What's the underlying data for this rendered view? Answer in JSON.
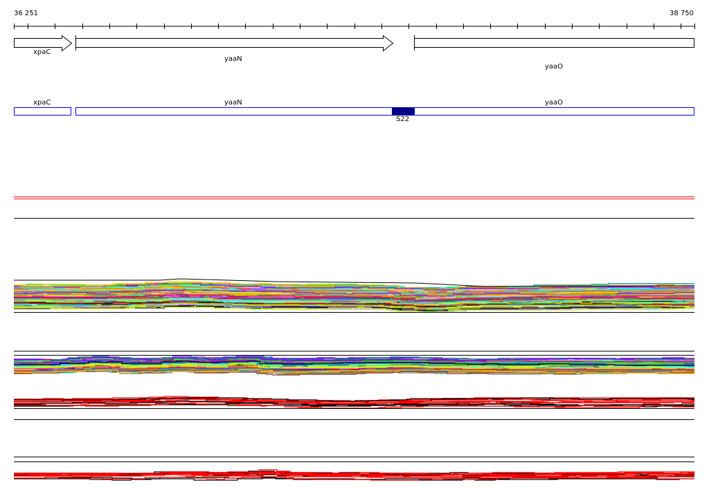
{
  "ruler": {
    "start_label": "36 251",
    "end_label": "38 750",
    "start": 36251,
    "end": 38750
  },
  "genes": [
    {
      "name": "xpaC",
      "strand": "+"
    },
    {
      "name": "yaaN",
      "strand": "+"
    },
    {
      "name": "yaaO",
      "strand": "none"
    }
  ],
  "annotations": {
    "features": [
      {
        "name": "xpaC"
      },
      {
        "name": "yaaN"
      },
      {
        "name": "yaaO"
      }
    ],
    "highlight": {
      "name": "S22"
    }
  },
  "colors": {
    "feature_outline": "#0000ff",
    "highlight_fill": "#00008b",
    "palette": [
      "#ff0000",
      "#00ff00",
      "#ff00ff",
      "#0080ff",
      "#808080",
      "#ff8000",
      "#00ffff",
      "#804040",
      "#8000ff",
      "#ccff00",
      "#000000",
      "#ffcc00",
      "#008080",
      "#c0c0c0"
    ]
  }
}
